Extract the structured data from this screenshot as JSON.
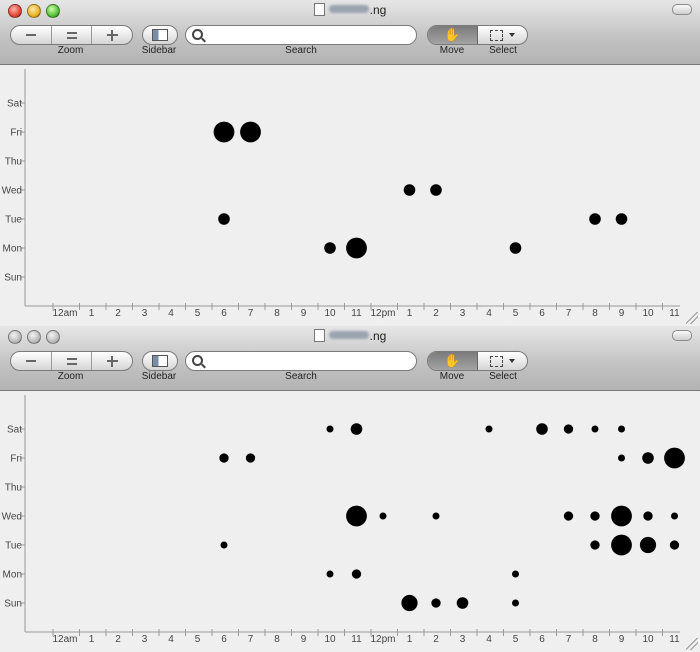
{
  "windows": [
    {
      "title_suffix": ".ng",
      "toolbar": {
        "zoom_label": "Zoom",
        "sidebar_label": "Sidebar",
        "search_label": "Search",
        "search_placeholder": "",
        "move_label": "Move",
        "select_label": "Select"
      }
    },
    {
      "title_suffix": ".ng",
      "toolbar": {
        "zoom_label": "Zoom",
        "sidebar_label": "Sidebar",
        "search_label": "Search",
        "search_placeholder": "",
        "move_label": "Move",
        "select_label": "Select"
      }
    }
  ],
  "colors": {
    "dot": "#000000",
    "axis": "#9a9a9a",
    "tick_text": "#444444"
  },
  "icons": [
    "minus-icon",
    "equals-icon",
    "plus-icon",
    "sidebar-icon",
    "search-icon",
    "hand-icon",
    "selection-icon",
    "chevron-down-icon"
  ],
  "chart_data": [
    {
      "type": "scatter",
      "title": "",
      "xlabel": "",
      "ylabel": "",
      "x_ticks": [
        "12am",
        "1",
        "2",
        "3",
        "4",
        "5",
        "6",
        "7",
        "8",
        "9",
        "10",
        "11",
        "12pm",
        "1",
        "2",
        "3",
        "4",
        "5",
        "6",
        "7",
        "8",
        "9",
        "10",
        "11"
      ],
      "y_ticks": [
        "Sun",
        "Mon",
        "Tue",
        "Wed",
        "Thu",
        "Fri",
        "Sat"
      ],
      "points": [
        {
          "hour": 6,
          "day": "Fri",
          "size": 4
        },
        {
          "hour": 7,
          "day": "Fri",
          "size": 4
        },
        {
          "hour": 13,
          "day": "Wed",
          "size": 2
        },
        {
          "hour": 14,
          "day": "Wed",
          "size": 2
        },
        {
          "hour": 6,
          "day": "Tue",
          "size": 2
        },
        {
          "hour": 20,
          "day": "Tue",
          "size": 2
        },
        {
          "hour": 21,
          "day": "Tue",
          "size": 2
        },
        {
          "hour": 10,
          "day": "Mon",
          "size": 2
        },
        {
          "hour": 11,
          "day": "Mon",
          "size": 4
        },
        {
          "hour": 17,
          "day": "Mon",
          "size": 2
        }
      ]
    },
    {
      "type": "scatter",
      "title": "",
      "xlabel": "",
      "ylabel": "",
      "x_ticks": [
        "12am",
        "1",
        "2",
        "3",
        "4",
        "5",
        "6",
        "7",
        "8",
        "9",
        "10",
        "11",
        "12pm",
        "1",
        "2",
        "3",
        "4",
        "5",
        "6",
        "7",
        "8",
        "9",
        "10",
        "11"
      ],
      "y_ticks": [
        "Sun",
        "Mon",
        "Tue",
        "Wed",
        "Thu",
        "Fri",
        "Sat"
      ],
      "points": [
        {
          "hour": 10,
          "day": "Sat",
          "size": 1
        },
        {
          "hour": 11,
          "day": "Sat",
          "size": 2
        },
        {
          "hour": 16,
          "day": "Sat",
          "size": 1
        },
        {
          "hour": 18,
          "day": "Sat",
          "size": 2
        },
        {
          "hour": 19,
          "day": "Sat",
          "size": 1.5
        },
        {
          "hour": 20,
          "day": "Sat",
          "size": 1
        },
        {
          "hour": 21,
          "day": "Sat",
          "size": 1
        },
        {
          "hour": 6,
          "day": "Fri",
          "size": 1.5
        },
        {
          "hour": 7,
          "day": "Fri",
          "size": 1.5
        },
        {
          "hour": 21,
          "day": "Fri",
          "size": 1
        },
        {
          "hour": 22,
          "day": "Fri",
          "size": 2
        },
        {
          "hour": 23,
          "day": "Fri",
          "size": 4
        },
        {
          "hour": 11,
          "day": "Wed",
          "size": 4
        },
        {
          "hour": 12,
          "day": "Wed",
          "size": 1
        },
        {
          "hour": 14,
          "day": "Wed",
          "size": 1
        },
        {
          "hour": 19,
          "day": "Wed",
          "size": 1.5
        },
        {
          "hour": 20,
          "day": "Wed",
          "size": 1.5
        },
        {
          "hour": 21,
          "day": "Wed",
          "size": 4
        },
        {
          "hour": 22,
          "day": "Wed",
          "size": 1.5
        },
        {
          "hour": 23,
          "day": "Wed",
          "size": 1
        },
        {
          "hour": 6,
          "day": "Tue",
          "size": 1
        },
        {
          "hour": 20,
          "day": "Tue",
          "size": 1.5
        },
        {
          "hour": 21,
          "day": "Tue",
          "size": 4
        },
        {
          "hour": 22,
          "day": "Tue",
          "size": 3
        },
        {
          "hour": 23,
          "day": "Tue",
          "size": 1.5
        },
        {
          "hour": 10,
          "day": "Mon",
          "size": 1
        },
        {
          "hour": 11,
          "day": "Mon",
          "size": 1.5
        },
        {
          "hour": 17,
          "day": "Mon",
          "size": 1
        },
        {
          "hour": 13,
          "day": "Sun",
          "size": 3
        },
        {
          "hour": 14,
          "day": "Sun",
          "size": 1.5
        },
        {
          "hour": 15,
          "day": "Sun",
          "size": 2
        },
        {
          "hour": 17,
          "day": "Sun",
          "size": 1
        }
      ]
    }
  ]
}
